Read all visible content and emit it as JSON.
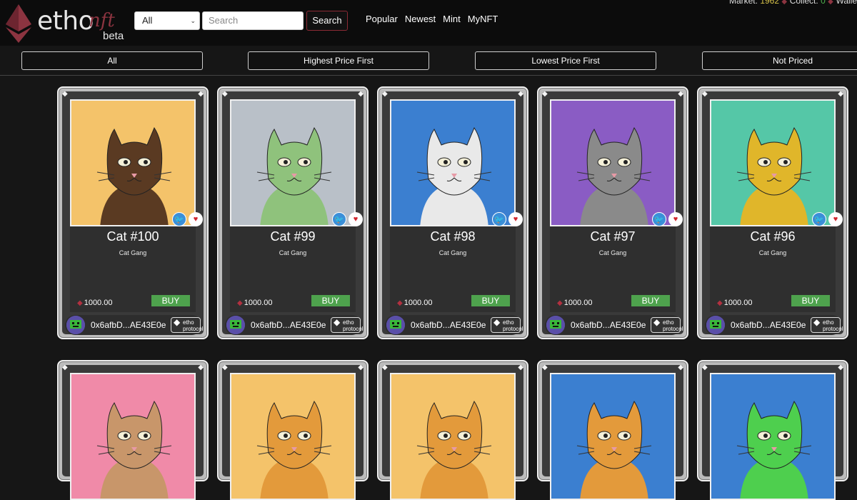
{
  "header": {
    "logo_word": "etho",
    "logo_nft": "nft",
    "logo_beta": "beta",
    "category_select": "All",
    "search_placeholder": "Search",
    "search_button": "Search",
    "nav": [
      "Popular",
      "Newest",
      "Mint",
      "MyNFT"
    ],
    "market_label": "Market:",
    "market_value": "1962",
    "collect_label": "Collect:",
    "collect_value": "0",
    "wallet_label": "Walle"
  },
  "filters": [
    "All",
    "Highest Price First",
    "Lowest Price First",
    "Not Priced"
  ],
  "icons": {
    "eth": "ethereum-diamond-icon",
    "twitter": "twitter-icon",
    "heart": "heart-icon"
  },
  "colors": {
    "buy_green": "#4ea24d",
    "brand_red": "#8c3440",
    "twitter_blue": "#3b8fd8"
  },
  "cards_row1": [
    {
      "title": "Cat #100",
      "collection": "Cat Gang",
      "price": "1000.00",
      "buy": "BUY",
      "owner": "0x6afbD...AE43E0e",
      "badge_top": "etho",
      "badge_bottom": "protocol",
      "bg": "#f4c36a",
      "fur": "#5a3a22"
    },
    {
      "title": "Cat #99",
      "collection": "Cat Gang",
      "price": "1000.00",
      "buy": "BUY",
      "owner": "0x6afbD...AE43E0e",
      "badge_top": "etho",
      "badge_bottom": "protocol",
      "bg": "#b9c0c8",
      "fur": "#8fc27c"
    },
    {
      "title": "Cat #98",
      "collection": "Cat Gang",
      "price": "1000.00",
      "buy": "BUY",
      "owner": "0x6afbD...AE43E0e",
      "badge_top": "etho",
      "badge_bottom": "protocol",
      "bg": "#3b7fd0",
      "fur": "#e9e9e9"
    },
    {
      "title": "Cat #97",
      "collection": "Cat Gang",
      "price": "1000.00",
      "buy": "BUY",
      "owner": "0x6afbD...AE43E0e",
      "badge_top": "etho",
      "badge_bottom": "protocol",
      "bg": "#8a5cc4",
      "fur": "#8a8a8a"
    },
    {
      "title": "Cat #96",
      "collection": "Cat Gang",
      "price": "1000.00",
      "buy": "BUY",
      "owner": "0x6afbD...AE43E0e",
      "badge_top": "etho",
      "badge_bottom": "protocol",
      "bg": "#55c7a7",
      "fur": "#e0b62a"
    }
  ],
  "cards_row2": [
    {
      "bg": "#f08aa8",
      "fur": "#c8966a"
    },
    {
      "bg": "#f4c36a",
      "fur": "#e39a3b"
    },
    {
      "bg": "#f4c36a",
      "fur": "#e39a3b"
    },
    {
      "bg": "#3b7fd0",
      "fur": "#e39a3b"
    },
    {
      "bg": "#3b7fd0",
      "fur": "#4ecf4e"
    }
  ]
}
